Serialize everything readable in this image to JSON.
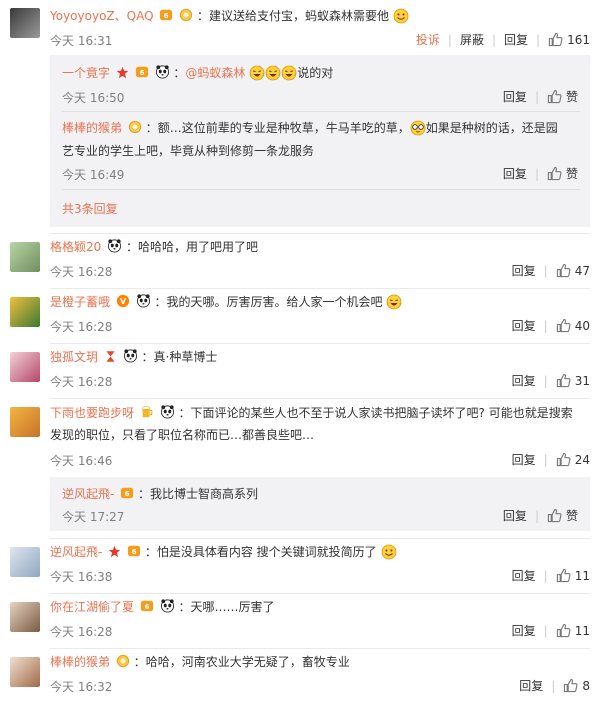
{
  "labels": {
    "reply": "回复",
    "report": "投诉",
    "block": "屏蔽",
    "like": "赞",
    "more_replies": "共3条回复"
  },
  "comments": [
    {
      "name": "YoyoyoyoZ、QAQ",
      "text": "建议送给支付宝，蚂蚁森林需要他",
      "time": "今天 16:31",
      "likes": "161"
    },
    {
      "name": "格格颖20",
      "text": "哈哈哈，用了吧用了吧",
      "time": "今天 16:28",
      "likes": "47"
    },
    {
      "name": "是橙子蓄哦",
      "text": "我的天哪。厉害厉害。给人家一个机会吧",
      "time": "今天 16:28",
      "likes": "40"
    },
    {
      "name": "独孤文玥",
      "text": "真·种草博士",
      "time": "今天 16:28",
      "likes": "31"
    },
    {
      "name": "下雨也要跑步呀",
      "text": "下面评论的某些人也不至于说人家读书把脑子读坏了吧? 可能也就是搜索",
      "text2": "发现的职位，只看了职位名称而已…都善良些吧…",
      "time": "今天 16:46",
      "likes": "24"
    },
    {
      "name": "逆风起飛-",
      "text": "怕是没具体看内容 搜个关键词就投简历了",
      "time": "今天 16:38",
      "likes": "11"
    },
    {
      "name": "你在江湖偷了夏",
      "text": "天哪……厉害了",
      "time": "今天 16:28",
      "likes": "11"
    },
    {
      "name": "棒棒的猴弟",
      "text": "哈哈，河南农业大学无疑了，畜牧专业",
      "time": "今天 16:32",
      "likes": "8"
    }
  ],
  "replies": [
    {
      "name": "一个竟字",
      "mention": "@蚂蚁森林",
      "text": "说的对",
      "time": "今天 16:50"
    },
    {
      "name": "棒棒的猴弟",
      "text": "额…这位前辈的专业是种牧草，牛马羊吃的草，",
      "text_b": "如果是种树的话，还是园",
      "text2": "艺专业的学生上吧，毕竟从种到修剪一条龙服务",
      "time": "今天 16:49"
    },
    {
      "name": "逆风起飛-",
      "text": "我比博士智商高系列",
      "time": "今天 17:27"
    }
  ],
  "colors": {
    "name": "#eb7350",
    "time": "#808080",
    "reply_bg": "#f2f2f5"
  }
}
